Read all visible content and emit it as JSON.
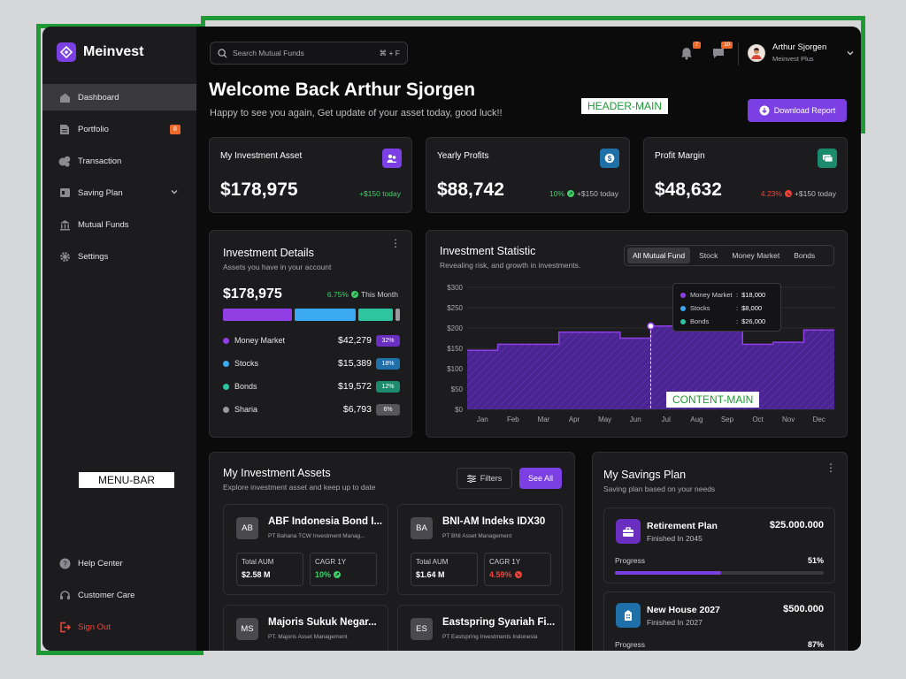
{
  "brand": {
    "name": "Meinvest",
    "accent": "#7b3fe4"
  },
  "annotations": {
    "header": "HEADER-MAIN",
    "menu": "MENU-BAR",
    "content": "CONTENT-MAIN"
  },
  "sidebar": {
    "items": [
      {
        "label": "Dashboard",
        "icon": "home-icon",
        "active": true
      },
      {
        "label": "Portfolio",
        "icon": "document-icon",
        "badge": "8"
      },
      {
        "label": "Transaction",
        "icon": "coins-icon"
      },
      {
        "label": "Saving Plan",
        "icon": "wallet-icon",
        "expandable": true
      },
      {
        "label": "Mutual Funds",
        "icon": "bank-icon"
      },
      {
        "label": "Settings",
        "icon": "gear-icon"
      }
    ],
    "bottom": [
      {
        "label": "Help Center",
        "icon": "help-icon"
      },
      {
        "label": "Customer Care",
        "icon": "headset-icon"
      },
      {
        "label": "Sign Out",
        "icon": "sign-out-icon"
      }
    ]
  },
  "header": {
    "search_placeholder": "Search Mutual Funds",
    "search_shortcut": "⌘ + F",
    "notifications_count": "7",
    "messages_count": "10",
    "user_name": "Arthur Sjorgen",
    "user_plan": "Meinvest Plus",
    "welcome": "Welcome Back Arthur Sjorgen",
    "welcome_sub": "Happy to see you again, Get update of your asset today, good luck!!",
    "download_label": "Download Report"
  },
  "stats": [
    {
      "title": "My Investment Asset",
      "value": "$178,975",
      "delta": "+$150 today",
      "icon": "users-icon",
      "color": "#7b3fe4"
    },
    {
      "title": "Yearly Profits",
      "value": "$88,742",
      "pct": "10%",
      "delta": "+$150 today",
      "icon": "dollar-icon",
      "color": "#1f6fa8"
    },
    {
      "title": "Profit Margin",
      "value": "$48,632",
      "pct": "4.23%",
      "delta": "+$150 today",
      "icon": "cash-icon",
      "color": "#1c8a6c"
    }
  ],
  "details": {
    "title": "Investment Details",
    "subtitle": "Assets you have in your account",
    "total": "$178,975",
    "change": "6.75%",
    "period": "This Month",
    "bar": [
      {
        "share": 32,
        "color": "#8f3fe4"
      },
      {
        "share": 28,
        "color": "#3aa9f0"
      },
      {
        "share": 16,
        "color": "#2dc5a0"
      },
      {
        "share": 2,
        "color": "#9a9a9e"
      }
    ],
    "rows": [
      {
        "name": "Money Market",
        "value": "$42,279",
        "pct": "32%",
        "color": "#8f3fe4",
        "badge": "#6a2fc0"
      },
      {
        "name": "Stocks",
        "value": "$15,389",
        "pct": "18%",
        "color": "#3aa9f0",
        "badge": "#1f6fa8"
      },
      {
        "name": "Bonds",
        "value": "$19,572",
        "pct": "12%",
        "color": "#2dc5a0",
        "badge": "#1c8a6c"
      },
      {
        "name": "Sharia",
        "value": "$6,793",
        "pct": "6%",
        "color": "#9a9a9e",
        "badge": "#55555a"
      }
    ]
  },
  "statistic": {
    "title": "Investment Statistic",
    "subtitle": "Revealing risk, and growth in investments.",
    "tabs": [
      "All Mutual Fund",
      "Stock",
      "Money Market",
      "Bonds"
    ],
    "tooltip": [
      {
        "name": "Money Market",
        "value": "$18,000",
        "color": "#8f3fe4"
      },
      {
        "name": "Stocks",
        "value": "$8,000",
        "color": "#3aa9f0"
      },
      {
        "name": "Bonds",
        "value": "$26,000",
        "color": "#2dc5a0"
      }
    ]
  },
  "chart_data": {
    "type": "area",
    "categories": [
      "Jan",
      "Feb",
      "Mar",
      "Apr",
      "May",
      "Jun",
      "Jul",
      "Aug",
      "Sep",
      "Oct",
      "Nov",
      "Dec"
    ],
    "values": [
      145,
      160,
      160,
      190,
      190,
      175,
      205,
      210,
      210,
      160,
      165,
      195
    ],
    "ylim": [
      0,
      300
    ],
    "yticks": [
      "$0",
      "$50",
      "$100",
      "$150",
      "$200",
      "$250",
      "$300"
    ],
    "highlight": "Jul",
    "color": "#8f3fe4"
  },
  "assets": {
    "title": "My Investment Assets",
    "subtitle": "Explore investment asset and keep up to date",
    "filters_label": "Filters",
    "see_all_label": "See All",
    "items": [
      {
        "abbr": "AB",
        "name": "ABF Indonesia Bond I...",
        "manager": "PT Bahana TCW Investment Manag...",
        "aum_label": "Total AUM",
        "aum": "$2.58 M",
        "cagr_label": "CAGR 1Y",
        "cagr": "10%",
        "up": true
      },
      {
        "abbr": "BA",
        "name": "BNI-AM Indeks IDX30",
        "manager": "PT BNI Asset Management",
        "aum_label": "Total AUM",
        "aum": "$1.64 M",
        "cagr_label": "CAGR 1Y",
        "cagr": "4.59%",
        "up": false
      },
      {
        "abbr": "MS",
        "name": "Majoris Sukuk Negar...",
        "manager": "PT. Majoris Asset Management"
      },
      {
        "abbr": "ES",
        "name": "Eastspring Syariah Fi...",
        "manager": "PT Eastspring Investments Indonesia"
      }
    ]
  },
  "savings": {
    "title": "My Savings Plan",
    "subtitle": "Saving plan based on your needs",
    "plans": [
      {
        "title": "Retirement Plan",
        "sub": "Finished In 2045",
        "amount": "$25.000.000",
        "progress_label": "Progress",
        "pct": "51%",
        "progress": 0.51,
        "icon": "briefcase-icon",
        "color": "#6a2fc0"
      },
      {
        "title": "New House 2027",
        "sub": "Finished In 2027",
        "amount": "$500.000",
        "progress_label": "Progress",
        "pct": "87%",
        "progress": 0.87,
        "icon": "building-icon",
        "color": "#1f6fa8"
      }
    ]
  }
}
